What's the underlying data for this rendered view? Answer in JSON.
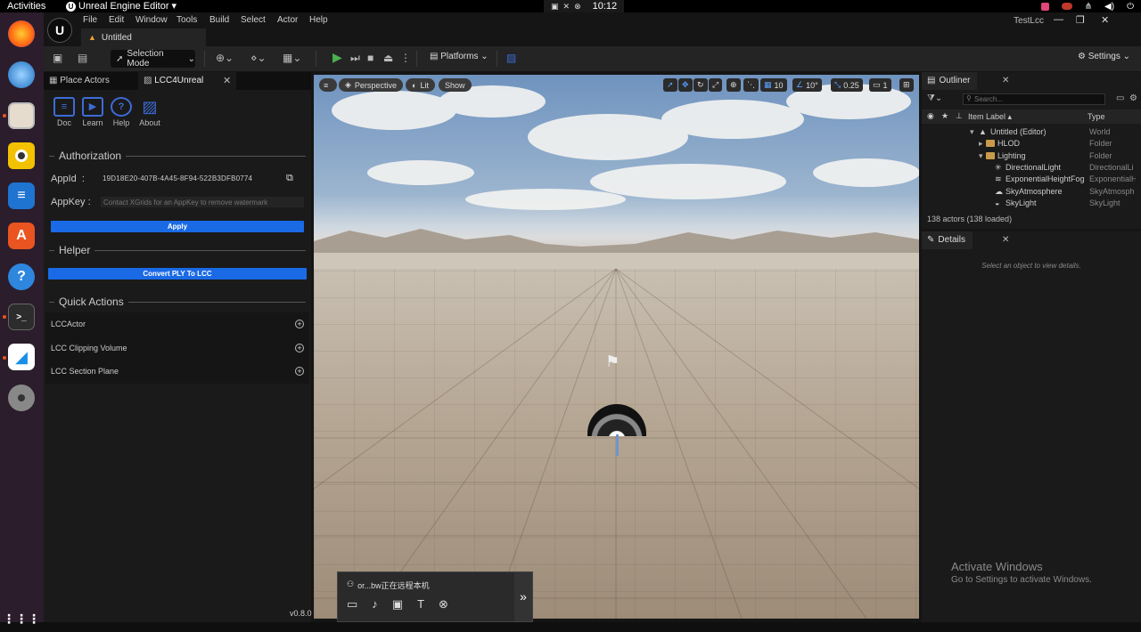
{
  "os": {
    "activities": "Activities",
    "app_menu": "Unreal Engine Editor ▾",
    "clock": "10:12",
    "dock_icons": [
      "firefox-icon",
      "thunderbird-icon",
      "files-icon",
      "rhythmbox-icon",
      "writer-icon",
      "app-center-icon",
      "help-icon",
      "terminal-icon",
      "remote-desktop-icon",
      "disc-icon",
      "show-apps-icon"
    ]
  },
  "menu": {
    "items": [
      "File",
      "Edit",
      "Window",
      "Tools",
      "Build",
      "Select",
      "Actor",
      "Help"
    ],
    "doc_tab": "Untitled",
    "project_name": "TestLcc"
  },
  "toolbar": {
    "selection_mode": "Selection Mode",
    "platforms": "Platforms",
    "settings": "Settings"
  },
  "left_panel": {
    "tabs": [
      "Place Actors",
      "LCC4Unreal"
    ],
    "tools": [
      "Doc",
      "Learn",
      "Help",
      "About"
    ],
    "authorization": "Authorization",
    "appid_label": "AppId",
    "appid_value": "19D18E20-407B-4A45-8F94-522B3DFB0774",
    "appkey_label": "AppKey",
    "appkey_placeholder": "Contact XGrids for an AppKey to remove watermark",
    "apply": "Apply",
    "helper": "Helper",
    "convert": "Convert PLY To LCC",
    "quick_actions": "Quick Actions",
    "actions": [
      "LCCActor",
      "LCC Clipping Volume",
      "LCC Section Plane"
    ],
    "version": "v0.8.0"
  },
  "viewport": {
    "perspective": "Perspective",
    "lit": "Lit",
    "show": "Show",
    "grid_snap": "10",
    "rot_snap": "10°",
    "scale_snap": "0.25",
    "camera_speed": "1"
  },
  "remote": {
    "title": "or...bw正在远程本机"
  },
  "outliner": {
    "tab": "Outliner",
    "search_placeholder": "Search...",
    "col_label": "Item Label ▴",
    "col_type": "Type",
    "rows": [
      {
        "label": "Untitled (Editor)",
        "type": "World"
      },
      {
        "label": "HLOD",
        "type": "Folder"
      },
      {
        "label": "Lighting",
        "type": "Folder"
      },
      {
        "label": "DirectionalLight",
        "type": "DirectionalLi"
      },
      {
        "label": "ExponentialHeightFog",
        "type": "ExponentialH"
      },
      {
        "label": "SkyAtmosphere",
        "type": "SkyAtmosph"
      },
      {
        "label": "SkyLight",
        "type": "SkyLight"
      }
    ],
    "count": "138 actors (138 loaded)"
  },
  "details": {
    "tab": "Details",
    "empty": "Select an object to view details."
  },
  "watermark": {
    "line1": "Activate Windows",
    "line2": "Go to Settings to activate Windows."
  },
  "colors": {
    "accent_blue": "#1a6ae6",
    "play_green": "#4caf50",
    "ubuntu_orange": "#e95420"
  }
}
